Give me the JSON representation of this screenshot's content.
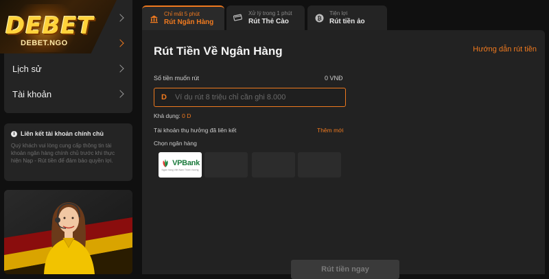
{
  "brand": {
    "logo_text": "DEBET",
    "logo_sub": "DEBET.NGO",
    "accent": "#f07a1f"
  },
  "sidebar": {
    "items": [
      {
        "label": ""
      },
      {
        "label": ""
      },
      {
        "label": "Lịch sử"
      },
      {
        "label": "Tài khoản"
      }
    ],
    "info": {
      "title": "Liên kết tài khoản chính chủ",
      "body": "Quý khách vui lòng cung cấp thông tin tài khoản ngân hàng chính chủ trước khi thực hiện Nạp - Rút tiền để đảm bảo quyền lợi."
    }
  },
  "tabs": [
    {
      "sub": "Chỉ mất 5 phút",
      "label": "Rút Ngân Hàng",
      "icon": "bank-icon"
    },
    {
      "sub": "Xử lý trong 1 phút",
      "label": "Rút Thẻ Cào",
      "icon": "card-icon"
    },
    {
      "sub": "Tiện lợi",
      "label": "Rút tiền ảo",
      "icon": "bitcoin-icon"
    }
  ],
  "main": {
    "title": "Rút Tiền Về Ngân Hàng",
    "guide_link": "Hướng dẫn rút tiền",
    "amount_label": "Số tiền muốn rút",
    "amount_value": "0 VNĐ",
    "currency_mark": "D",
    "amount_placeholder": "Ví dụ rút 8 triệu chỉ cần ghi 8.000",
    "available_label": "Khả dụng:",
    "available_value": "0 D",
    "linked_label": "Tài khoản thụ hưởng đã liên kết",
    "add_new": "Thêm mới",
    "choose_bank": "Chọn ngân hàng",
    "banks": [
      {
        "name": "VPBank",
        "tagline": "Ngân hàng Việt Nam Thịnh Vượng"
      }
    ],
    "submit": "Rút tiền ngay"
  }
}
